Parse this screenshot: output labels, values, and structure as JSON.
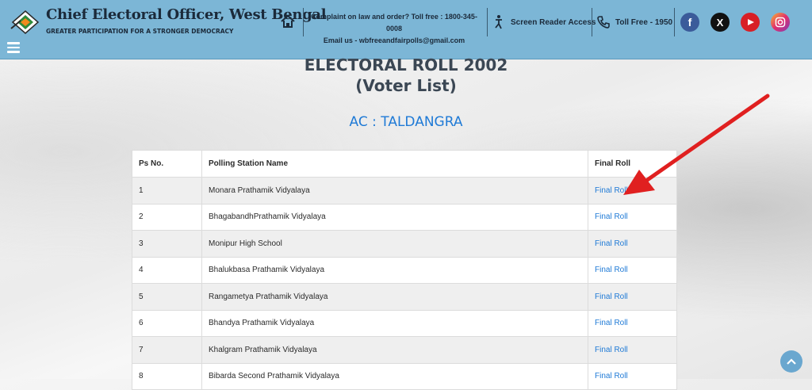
{
  "header": {
    "brand_title": "Chief Electoral Officer, West Bengal",
    "brand_tagline": "GREATER PARTICIPATION FOR A STRONGER DEMOCRACY",
    "complaint_line1": "Complaint on law and order? Toll free : 1800-345-0008",
    "complaint_line2": "Email us - wbfreeandfairpolls@gmail.com",
    "screen_reader_label": "Screen Reader Access",
    "toll_free_label": "Toll Free - 1950",
    "colors": {
      "bar": "#7cb6d6",
      "text": "#1b2a3a"
    },
    "icons": [
      "menu-icon",
      "home-icon",
      "accessibility-icon",
      "phone-icon",
      "facebook-icon",
      "x-icon",
      "youtube-icon",
      "instagram-icon"
    ]
  },
  "page": {
    "title_line1": "ELECTORAL ROLL 2002",
    "title_line2": "(Voter List)",
    "ac_label": "AC : TALDANGRA",
    "accent": "#1f7ad6"
  },
  "table": {
    "headers": [
      "Ps No.",
      "Polling Station Name",
      "Final Roll"
    ],
    "rows": [
      {
        "ps_no": "1",
        "name": "Monara Prathamik Vidyalaya",
        "link": "Final Roll"
      },
      {
        "ps_no": "2",
        "name": "BhagabandhPrathamik Vidyalaya",
        "link": "Final Roll"
      },
      {
        "ps_no": "3",
        "name": "Monipur High School",
        "link": "Final Roll"
      },
      {
        "ps_no": "4",
        "name": "Bhalukbasa Prathamik Vidyalaya",
        "link": "Final Roll"
      },
      {
        "ps_no": "5",
        "name": "Rangametya Prathamik Vidyalaya",
        "link": "Final Roll"
      },
      {
        "ps_no": "6",
        "name": "Bhandya Prathamik Vidyalaya",
        "link": "Final Roll"
      },
      {
        "ps_no": "7",
        "name": "Khalgram Prathamik Vidyalaya",
        "link": "Final Roll"
      },
      {
        "ps_no": "8",
        "name": "Bibarda Second Prathamik Vidyalaya",
        "link": "Final Roll"
      }
    ]
  },
  "annotation": {
    "arrow_color": "#e02020"
  }
}
